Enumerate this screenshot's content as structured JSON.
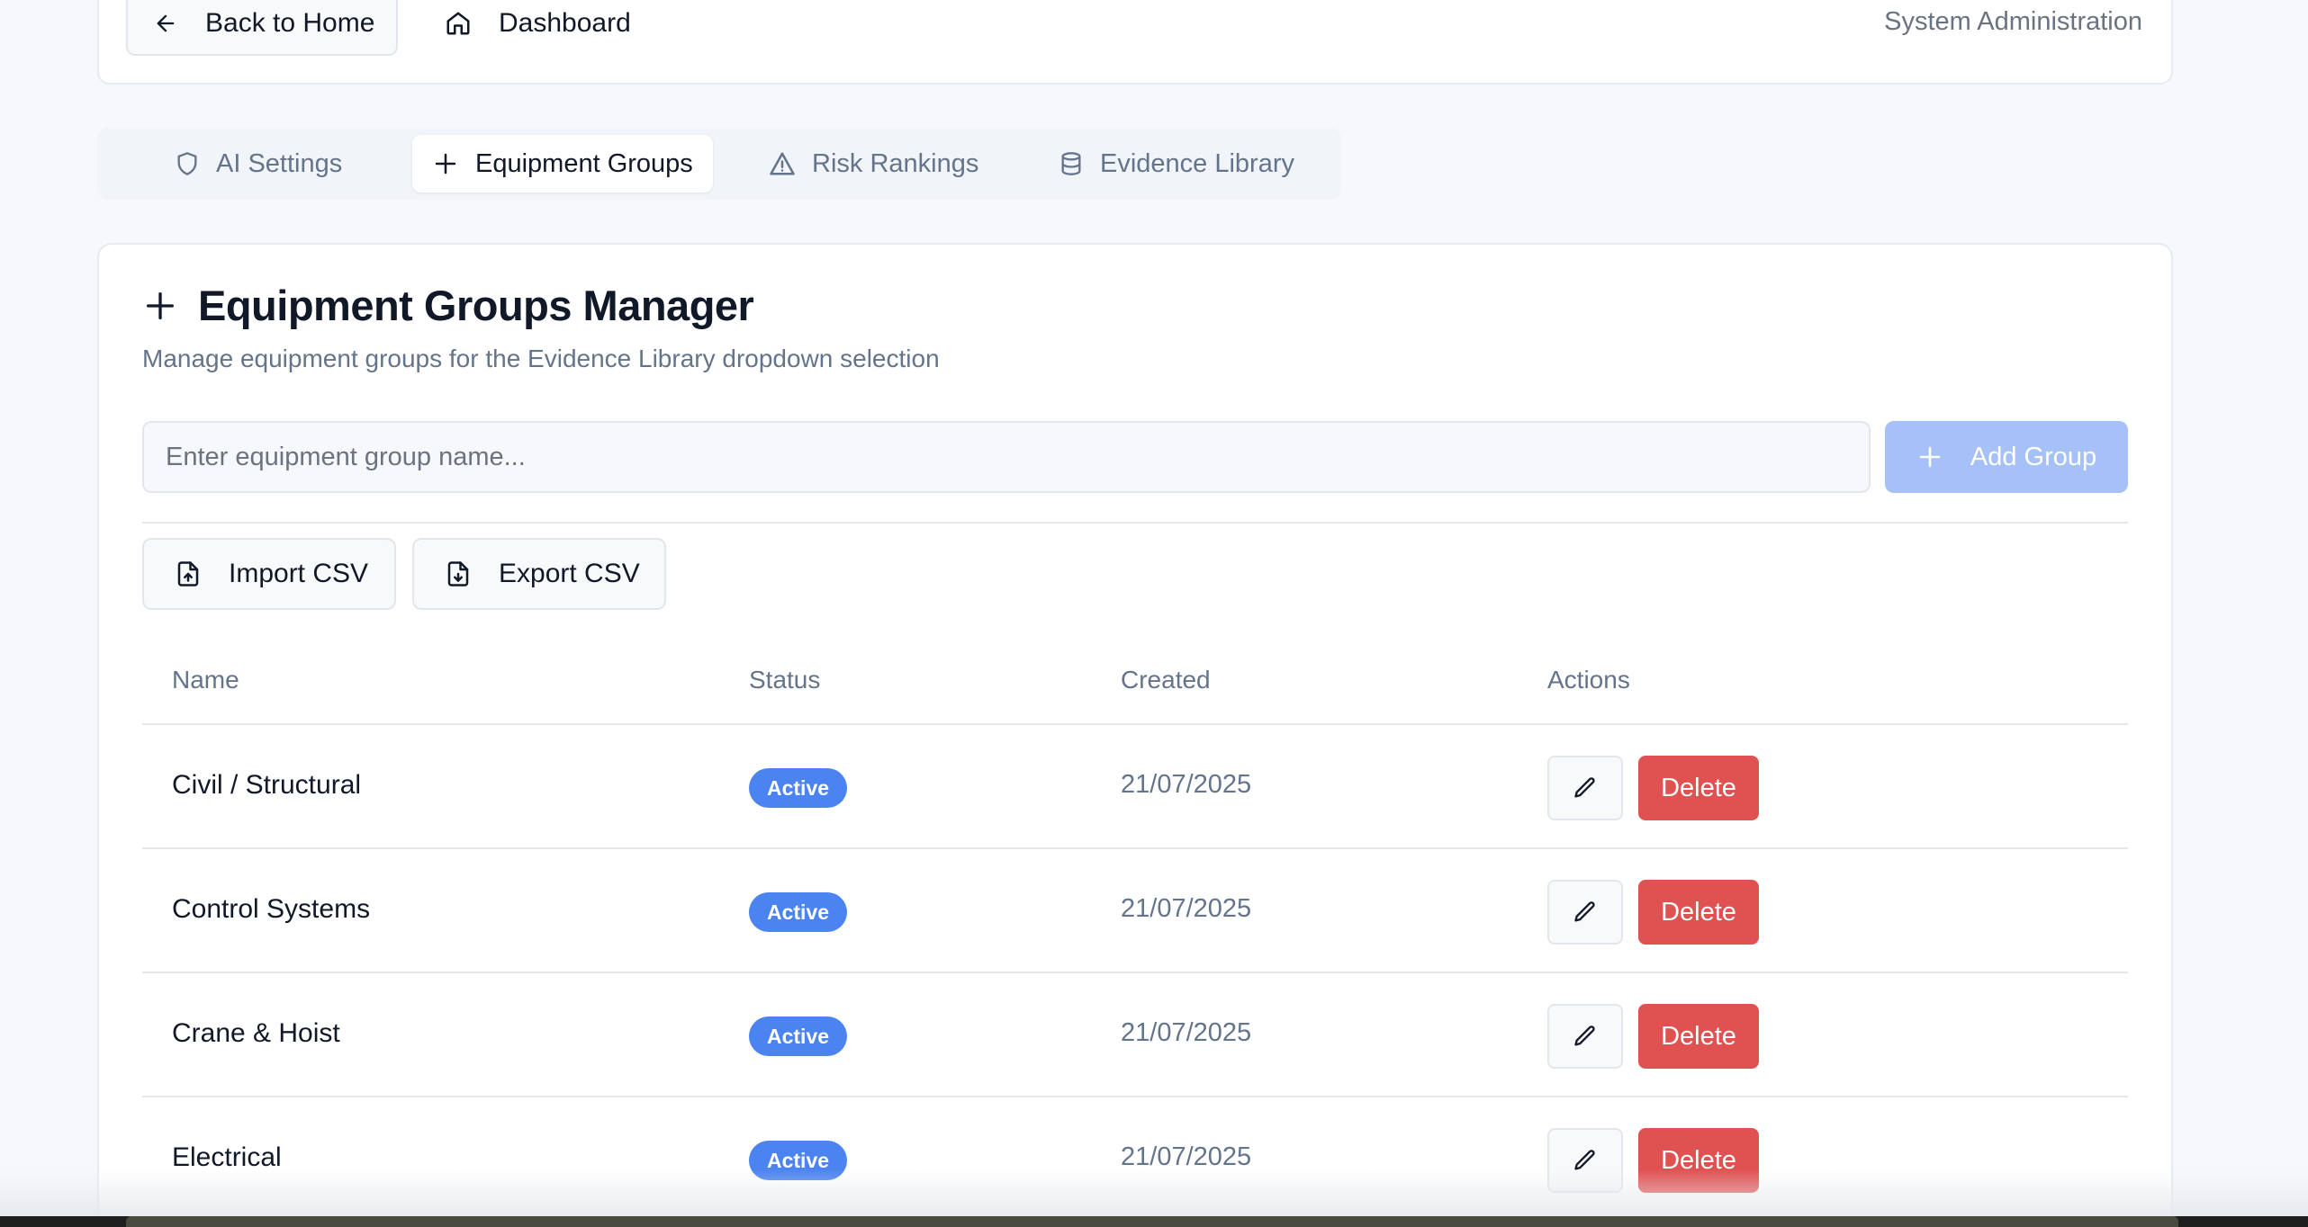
{
  "header": {
    "back_label": "Back to Home",
    "dashboard_label": "Dashboard",
    "section_label": "System Administration"
  },
  "tabs": [
    {
      "label": "AI Settings",
      "icon": "shield-icon",
      "active": false
    },
    {
      "label": "Equipment Groups",
      "icon": "plus-icon",
      "active": true
    },
    {
      "label": "Risk Rankings",
      "icon": "warning-triangle-icon",
      "active": false
    },
    {
      "label": "Evidence Library",
      "icon": "database-icon",
      "active": false
    }
  ],
  "manager": {
    "title": "Equipment Groups Manager",
    "subtitle": "Manage equipment groups for the Evidence Library dropdown selection",
    "input_placeholder": "Enter equipment group name...",
    "input_value": "",
    "add_label": "Add Group",
    "import_label": "Import CSV",
    "export_label": "Export CSV"
  },
  "table": {
    "columns": [
      "Name",
      "Status",
      "Created",
      "Actions"
    ],
    "rows": [
      {
        "name": "Civil / Structural",
        "status": "Active",
        "created": "21/07/2025",
        "delete_label": "Delete"
      },
      {
        "name": "Control Systems",
        "status": "Active",
        "created": "21/07/2025",
        "delete_label": "Delete"
      },
      {
        "name": "Crane & Hoist",
        "status": "Active",
        "created": "21/07/2025",
        "delete_label": "Delete"
      },
      {
        "name": "Electrical",
        "status": "Active",
        "created": "21/07/2025",
        "delete_label": "Delete"
      }
    ]
  },
  "colors": {
    "accent_blue": "#4b83f0",
    "add_button_disabled": "#a6c1f8",
    "delete_red": "#e05252"
  }
}
